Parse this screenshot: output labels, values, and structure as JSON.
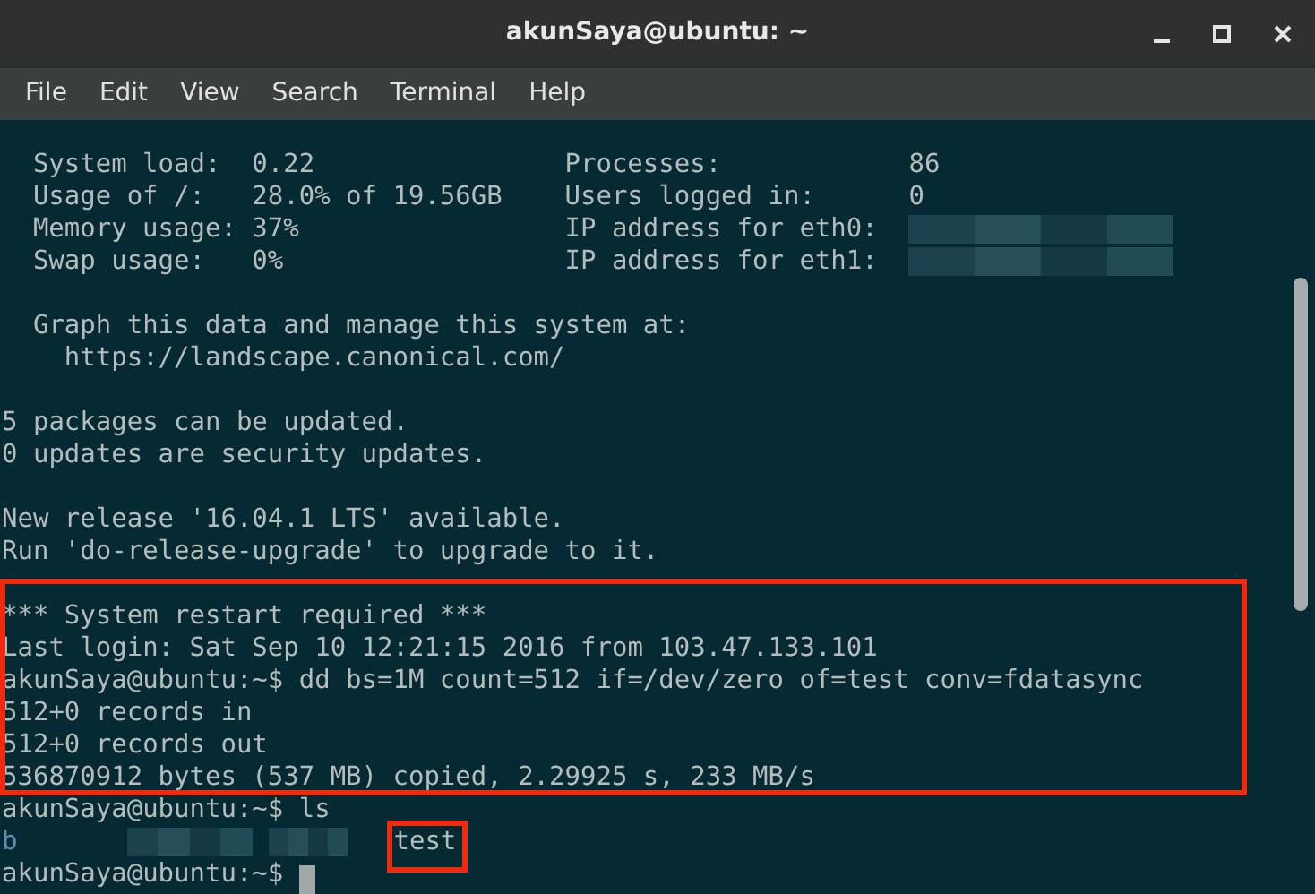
{
  "window": {
    "title": "akunSaya@ubuntu: ~"
  },
  "menu": [
    "File",
    "Edit",
    "View",
    "Search",
    "Terminal",
    "Help"
  ],
  "blocks": [
    {
      "highlighted": false,
      "lines": [
        {
          "kind": "sysinfo",
          "left": "System load:  0.22",
          "right_label": "Processes:",
          "right_value": "86"
        },
        {
          "kind": "sysinfo",
          "left": "Usage of /:   28.0% of 19.56GB",
          "right_label": "Users logged in:",
          "right_value": "0"
        },
        {
          "kind": "sysinfo",
          "left": "Memory usage: 37%",
          "right_label": "IP address for eth0:",
          "redacted": true
        },
        {
          "kind": "sysinfo",
          "left": "Swap usage:   0%",
          "right_label": "IP address for eth1:",
          "redacted": true
        },
        {
          "kind": "blank"
        },
        {
          "kind": "text",
          "text": "  Graph this data and manage this system at:"
        },
        {
          "kind": "text",
          "text": "    https://landscape.canonical.com/"
        },
        {
          "kind": "blank"
        },
        {
          "kind": "text",
          "text": "5 packages can be updated."
        },
        {
          "kind": "text",
          "text": "0 updates are security updates."
        },
        {
          "kind": "blank"
        },
        {
          "kind": "text",
          "text": "New release '16.04.1 LTS' available."
        },
        {
          "kind": "text",
          "text": "Run 'do-release-upgrade' to upgrade to it."
        },
        {
          "kind": "blank"
        }
      ]
    },
    {
      "highlighted": true,
      "lines": [
        {
          "kind": "text",
          "text": "*** System restart required ***"
        },
        {
          "kind": "text",
          "text": "Last login: Sat Sep 10 12:21:15 2016 from 103.47.133.101"
        },
        {
          "kind": "text",
          "text": "akunSaya@ubuntu:~$ dd bs=1M count=512 if=/dev/zero of=test conv=fdatasync"
        },
        {
          "kind": "text",
          "text": "512+0 records in"
        },
        {
          "kind": "text",
          "text": "512+0 records out"
        },
        {
          "kind": "text",
          "text": "536870912 bytes (537 MB) copied, 2.29925 s, 233 MB/s"
        }
      ]
    },
    {
      "highlighted": false,
      "lines": [
        {
          "kind": "text",
          "text": "akunSaya@ubuntu:~$ ls"
        },
        {
          "kind": "ls_output",
          "first": "b",
          "last": "test",
          "last_highlighted": true
        },
        {
          "kind": "prompt",
          "text": "akunSaya@ubuntu:~$",
          "cursor": true
        }
      ]
    }
  ]
}
